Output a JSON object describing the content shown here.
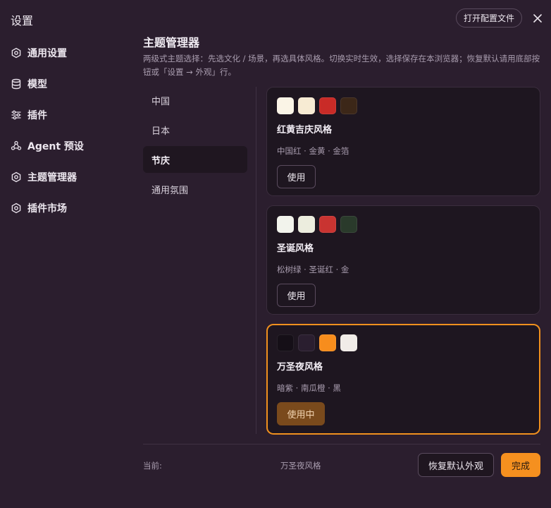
{
  "app": {
    "title": "设置"
  },
  "header": {
    "open_config_label": "打开配置文件"
  },
  "sidebar": {
    "items": [
      {
        "label": "通用设置",
        "icon": "gear-icon"
      },
      {
        "label": "模型",
        "icon": "database-icon"
      },
      {
        "label": "插件",
        "icon": "sliders-icon"
      },
      {
        "label": "Agent 预设",
        "icon": "agent-icon"
      },
      {
        "label": "主题管理器",
        "icon": "gear-icon"
      },
      {
        "label": "插件市场",
        "icon": "gear-icon"
      }
    ]
  },
  "main": {
    "title": "主题管理器",
    "description": "两级式主题选择：先选文化 / 场景，再选具体风格。切换实时生效，选择保存在本浏览器；恢复默认请用底部按钮或「设置 → 外观」行。",
    "categories": [
      {
        "label": "中国",
        "active": false
      },
      {
        "label": "日本",
        "active": false
      },
      {
        "label": "节庆",
        "active": true
      },
      {
        "label": "通用氛围",
        "active": false
      }
    ],
    "themes": [
      {
        "name": "红黄吉庆风格",
        "subtitle": "中国红 · 金黄 · 金箔",
        "swatches": [
          "#faf4e6",
          "#f7ebd3",
          "#c92b27",
          "#3c2718"
        ],
        "button_label": "使用",
        "active": false
      },
      {
        "name": "圣诞风格",
        "subtitle": "松树绿 · 圣诞红 · 金",
        "swatches": [
          "#f2f3ec",
          "#ecedde",
          "#c93431",
          "#2a3a2b"
        ],
        "button_label": "使用",
        "active": false
      },
      {
        "name": "万圣夜风格",
        "subtitle": "暗紫 · 南瓜橙 · 黑",
        "swatches": [
          "#150f17",
          "#2a1e2f",
          "#f78d1d",
          "#f1ece8"
        ],
        "button_label": "使用中",
        "active": true
      }
    ]
  },
  "footer": {
    "current_label": "当前:",
    "current_value": "万圣夜风格",
    "reset_label": "恢复默认外观",
    "done_label": "完成"
  },
  "colors": {
    "accent": "#f5901f",
    "background": "#2b1e2e",
    "card": "#1e1620"
  }
}
